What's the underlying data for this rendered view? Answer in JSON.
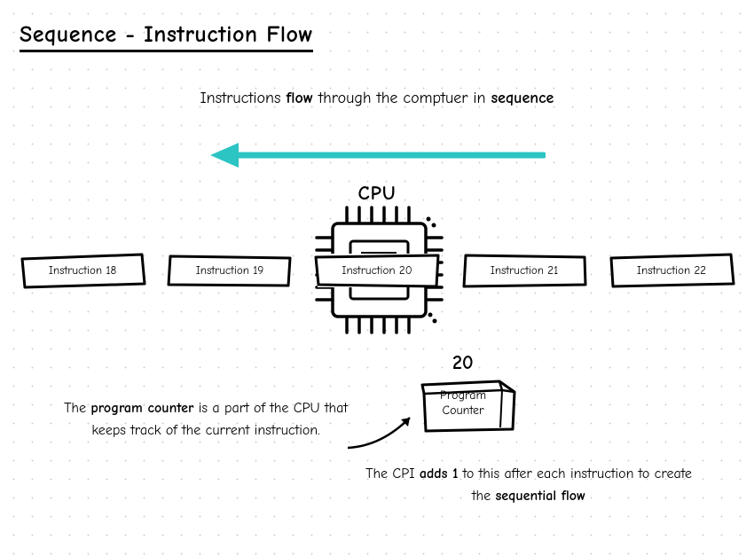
{
  "title": "Sequence - Instruction Flow",
  "subtitle_parts": [
    "Instructions ",
    "flow",
    " through the comptuer in ",
    "sequence"
  ],
  "arrow_color": "#2dc4c4",
  "cpu_label": "CPU",
  "instructions": [
    "Instruction 18",
    "Instruction 19",
    "Instruction 20",
    "Instruction 21",
    "Instruction 22"
  ],
  "program_counter": {
    "value": "20",
    "label_line1": "Program",
    "label_line2": "Counter"
  },
  "caption_left_parts": [
    "The ",
    "program counter",
    " is a part of the CPU that keeps track of the current instruction."
  ],
  "caption_right_parts": [
    "The CPI ",
    "adds 1",
    " to this after each instruction to create the ",
    "sequential flow"
  ]
}
